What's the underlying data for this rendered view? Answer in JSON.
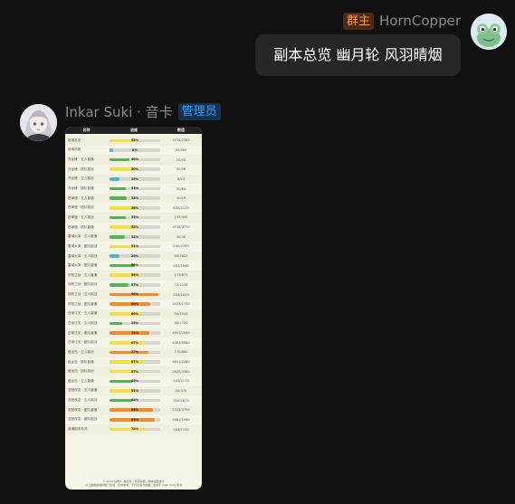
{
  "colors": {
    "background": "#111111",
    "bubble": "#262626",
    "owner_badge": "#ff9a4c",
    "admin_badge": "#3aa0ff",
    "bar_yellow": "#efe04a",
    "bar_green": "#55b257",
    "bar_orange": "#f28b30",
    "bar_cyan": "#48b6cf"
  },
  "message_right": {
    "badge": "群主",
    "sender": "HornCopper",
    "text": "副本总览 幽月轮 风羽晴烟",
    "avatar_icon": "frog-avatar-icon"
  },
  "message_left": {
    "sender": "Inkar Suki · 音卡",
    "badge": "管理员",
    "avatar_icon": "anime-girl-avatar-icon",
    "card": {
      "headers": [
        "名称",
        "进度",
        "数值"
      ],
      "rows": [
        {
          "name": "秘境总览",
          "pct": 0.52,
          "label": "52%",
          "color": "yellow",
          "value": "1234/2385"
        },
        {
          "name": "秘境总数",
          "pct": 0.08,
          "label": "8%",
          "color": "cyan",
          "value": "40/465"
        },
        {
          "name": "冷龙峰 · 五人普通",
          "pct": 0.4,
          "label": "40%",
          "color": "green",
          "value": "20/50"
        },
        {
          "name": "冷龙峰 · 团队挑战",
          "pct": 0.5,
          "label": "50%",
          "color": "yellow",
          "value": "50/98"
        },
        {
          "name": "冷龙峰 · 五人挑战",
          "pct": 0.19,
          "label": "19%",
          "color": "cyan",
          "value": "8/43"
        },
        {
          "name": "冷龙峰 · 团队普通",
          "pct": 0.33,
          "label": "33%",
          "color": "green",
          "value": "20/60"
        },
        {
          "name": "西津渡 · 五人普通",
          "pct": 0.34,
          "label": "34%",
          "color": "green",
          "value": "10/29"
        },
        {
          "name": "西津渡 · 团队挑战",
          "pct": 0.56,
          "label": "56%",
          "color": "yellow",
          "value": "635/1123"
        },
        {
          "name": "西津渡 · 五人挑战",
          "pct": 0.33,
          "label": "33%",
          "color": "green",
          "value": "143/440"
        },
        {
          "name": "西津渡 · 团队普通",
          "pct": 0.52,
          "label": "52%",
          "color": "yellow",
          "value": "1736/3770"
        },
        {
          "name": "雷域大泽 · 五人普通",
          "pct": 0.31,
          "label": "31%",
          "color": "green",
          "value": "30/40"
        },
        {
          "name": "雷域大泽 · 团队挑战",
          "pct": 0.51,
          "label": "51%",
          "color": "yellow",
          "value": "245/2350"
        },
        {
          "name": "雷域大泽 · 五人挑战",
          "pct": 0.2,
          "label": "20%",
          "color": "cyan",
          "value": "69/1623"
        },
        {
          "name": "雷域大泽 · 团队普通",
          "pct": 0.5,
          "label": "50%",
          "color": "green",
          "value": "200/1980"
        },
        {
          "name": "河阳之战 · 五人普通",
          "pct": 0.59,
          "label": "59%",
          "color": "yellow",
          "value": "113/871"
        },
        {
          "name": "河阳之战 · 团队挑战",
          "pct": 0.37,
          "label": "37%",
          "color": "green",
          "value": "72/1026"
        },
        {
          "name": "河阳之战 · 五人挑战",
          "pct": 0.96,
          "label": "96%",
          "color": "orange",
          "value": "239/1023"
        },
        {
          "name": "河阳之战 · 团队普通",
          "pct": 0.8,
          "label": "80%",
          "color": "orange",
          "value": "1423/1753"
        },
        {
          "name": "白帝江关 · 五人普通",
          "pct": 0.6,
          "label": "60%",
          "color": "yellow",
          "value": "36/1543"
        },
        {
          "name": "白帝江关 · 五人挑战",
          "pct": 0.25,
          "label": "25%",
          "color": "green",
          "value": "38/1720"
        },
        {
          "name": "白帝江关 · 团队普通",
          "pct": 0.79,
          "label": "79%",
          "color": "orange",
          "value": "1991/2050"
        },
        {
          "name": "白帝江关 · 团队挑战",
          "pct": 0.67,
          "label": "67%",
          "color": "yellow",
          "value": "4363/6580"
        },
        {
          "name": "敖龙岛 · 五人挑战",
          "pct": 0.77,
          "label": "77%",
          "color": "orange",
          "value": "770/860"
        },
        {
          "name": "敖龙岛 · 团队普通",
          "pct": 0.67,
          "label": "67%",
          "color": "yellow",
          "value": "3651/2280"
        },
        {
          "name": "敖龙岛 · 团队挑战",
          "pct": 0.57,
          "label": "57%",
          "color": "yellow",
          "value": "2625/3380"
        },
        {
          "name": "敖龙岛 · 五人普通",
          "pct": 0.45,
          "label": "45%",
          "color": "green",
          "value": "103/1173"
        },
        {
          "name": "范阳夜变 · 五人普通",
          "pct": 0.51,
          "label": "51%",
          "color": "yellow",
          "value": "20/370"
        },
        {
          "name": "范阳夜变 · 五人挑战",
          "pct": 0.44,
          "label": "44%",
          "color": "green",
          "value": "390/1873"
        },
        {
          "name": "范阳夜变 · 团队普通",
          "pct": 0.86,
          "label": "86%",
          "color": "orange",
          "value": "2723/3795"
        },
        {
          "name": "范阳夜变 · 团队挑战",
          "pct": 0.89,
          "label": "89%",
          "color": "orange",
          "value": "5481/5945"
        },
        {
          "name": "普通副本总览",
          "pct": 0.72,
          "label": "72%",
          "color": "yellow",
          "value": "343/1152"
        }
      ],
      "footer_line1": "© 2024 剑网3 · 幽月轮 · 风羽晴烟 · 副本进度统计",
      "footer_line2": "以上数据由插件统计生成，仅供参考，不代表官方数据。生成于 Inkar Suki 音卡"
    }
  }
}
